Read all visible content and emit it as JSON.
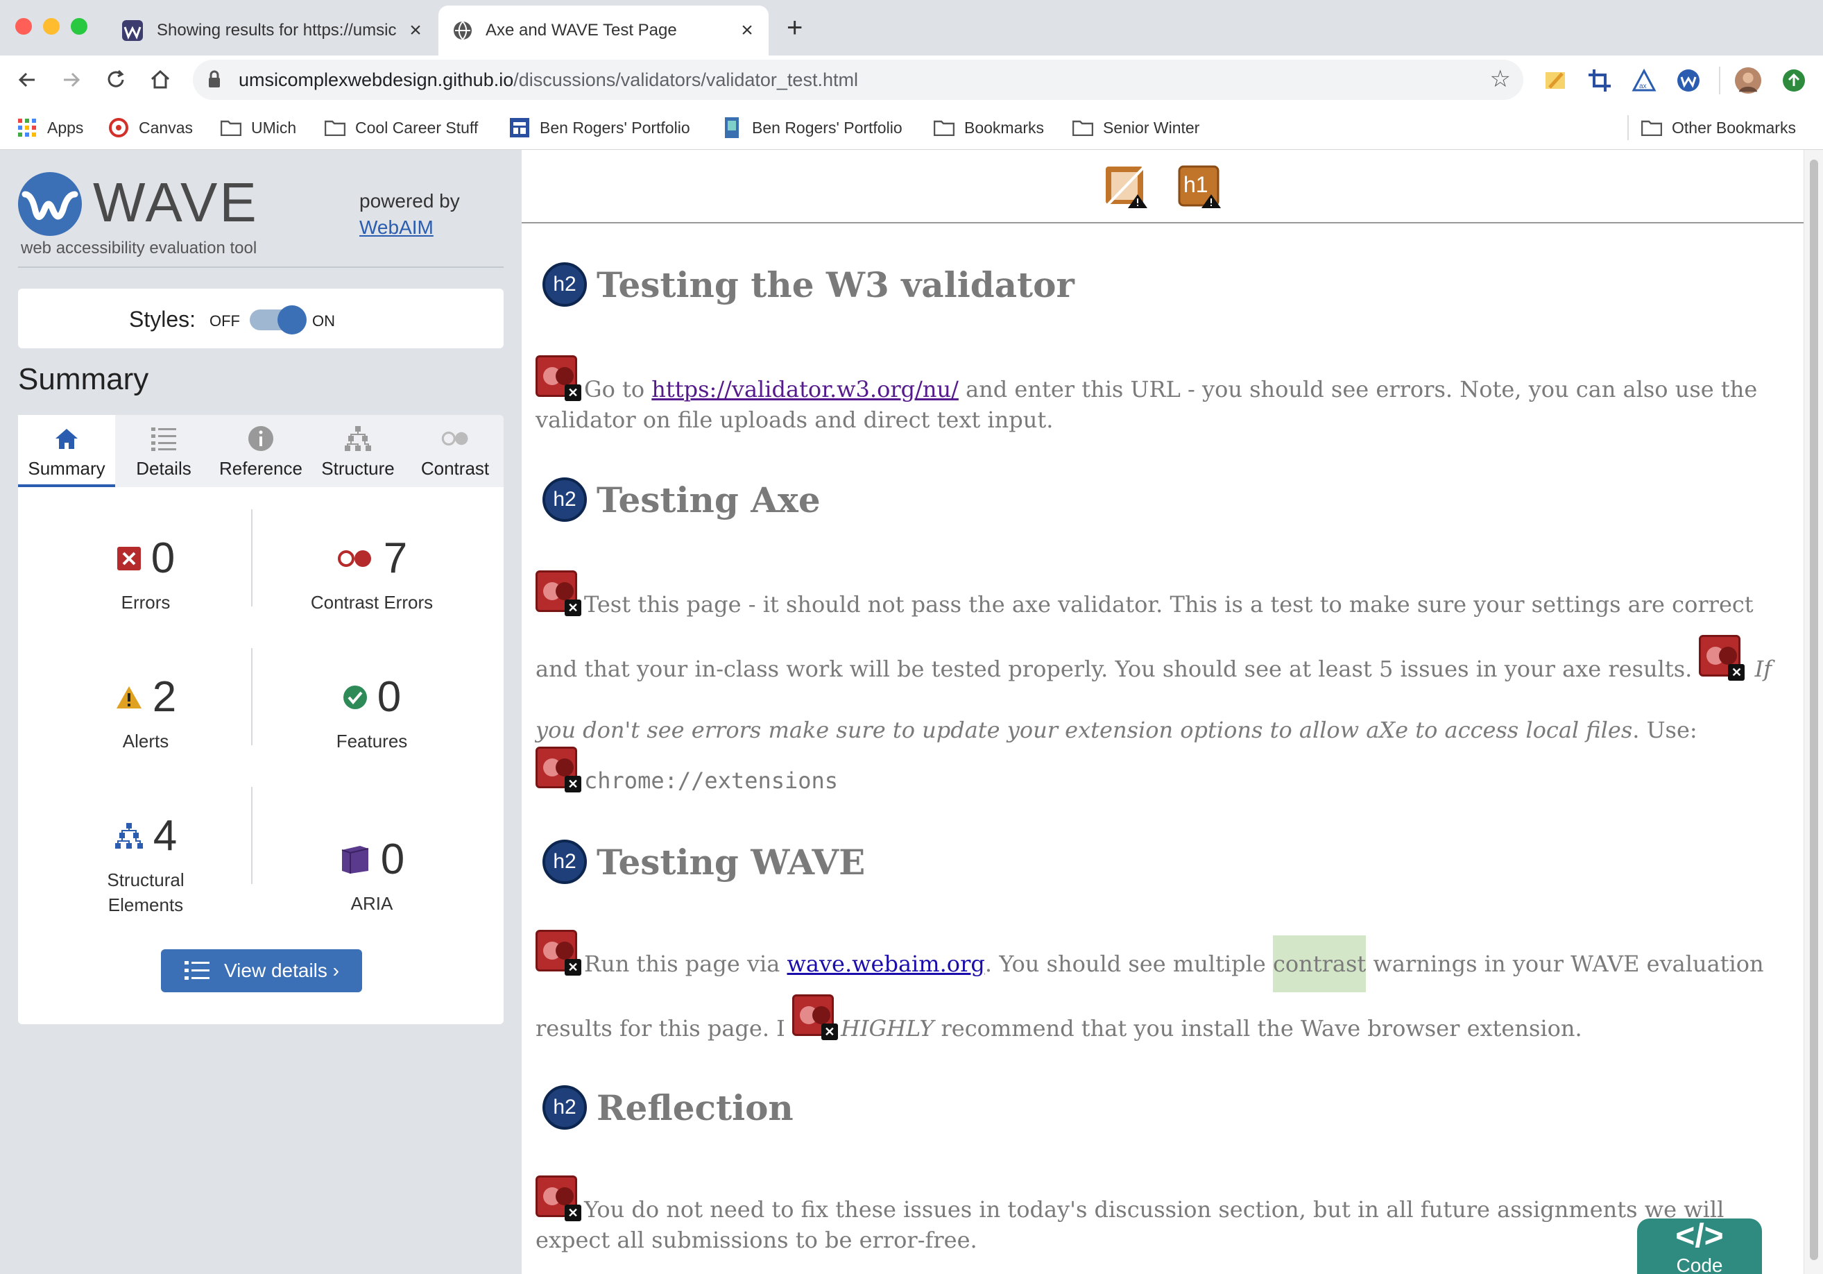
{
  "browser": {
    "tabs": [
      {
        "title": "Showing results for https://umsic",
        "active": false,
        "icon": "wave-favicon"
      },
      {
        "title": "Axe and WAVE Test Page",
        "active": true,
        "icon": "globe-icon"
      }
    ],
    "url": {
      "host": "umsicomplexwebdesign.github.io",
      "path": "/discussions/validators/validator_test.html"
    },
    "bookmarks": [
      {
        "label": "Apps",
        "icon": "apps-grid-icon"
      },
      {
        "label": "Canvas",
        "icon": "canvas-icon"
      },
      {
        "label": "UMich",
        "icon": "folder-icon"
      },
      {
        "label": "Cool Career Stuff",
        "icon": "folder-icon"
      },
      {
        "label": "Ben Rogers' Portfolio",
        "icon": "portfolio-icon"
      },
      {
        "label": "Ben Rogers' Portfolio",
        "icon": "portfolio-icon-2"
      },
      {
        "label": "Bookmarks",
        "icon": "folder-icon"
      },
      {
        "label": "Senior Winter",
        "icon": "folder-icon"
      },
      {
        "label": "Other Bookmarks",
        "icon": "folder-icon"
      }
    ]
  },
  "wave": {
    "title": "WAVE",
    "subtitle": "web accessibility evaluation tool",
    "powered_by": "powered by",
    "webaim": "WebAIM",
    "styles_label": "Styles:",
    "off": "OFF",
    "on": "ON",
    "summary_heading": "Summary",
    "tabs": [
      "Summary",
      "Details",
      "Reference",
      "Structure",
      "Contrast"
    ],
    "stats": {
      "errors": {
        "count": "0",
        "label": "Errors"
      },
      "contrast": {
        "count": "7",
        "label": "Contrast Errors"
      },
      "alerts": {
        "count": "2",
        "label": "Alerts"
      },
      "features": {
        "count": "0",
        "label": "Features"
      },
      "structural": {
        "count": "4",
        "label_line1": "Structural",
        "label_line2": "Elements"
      },
      "aria": {
        "count": "0",
        "label": "ARIA"
      }
    },
    "view_details": "View details ›",
    "colors": {
      "accent": "#3b6fb6",
      "error": "#b52a2a",
      "alert": "#e0a020",
      "feature": "#2e8b57",
      "aria": "#5a3a8c"
    }
  },
  "page": {
    "sections": [
      {
        "heading": "Testing the W3 validator",
        "p1_before": "Go to ",
        "p1_link": "https://validator.w3.org/nu/",
        "p1_after": " and enter this URL - you should see errors. Note, you can also use the validator on file uploads and direct text input."
      },
      {
        "heading": "Testing Axe",
        "p1": "Test this page - it should not pass the axe validator. This is a test to make sure your settings are correct and that your in-class work will be tested properly. You should see at least 5 issues in your axe results. ",
        "p1_italic": "If you don't see errors make sure to update your extension options to allow aXe to access local files",
        "p1_end": ". Use:",
        "code": "chrome://extensions"
      },
      {
        "heading": "Testing WAVE",
        "p1_before": "Run this page via ",
        "p1_link": "wave.webaim.org",
        "p1_mid": ". You should see multiple ",
        "p1_highlight": "contrast",
        "p1_after": " warnings in your WAVE evaluation results for this page. I ",
        "p1_italic": "HIGHLY",
        "p1_end": " recommend that you install the Wave browser extension."
      },
      {
        "heading": "Reflection",
        "p1": "You do not need to fix these issues in today's discussion section, but in all future assignments we will expect all submissions to be error-free."
      }
    ],
    "badge_h2": "h2",
    "badge_h1": "h1",
    "code_tab": {
      "glyph": "</>",
      "label": "Code"
    }
  }
}
